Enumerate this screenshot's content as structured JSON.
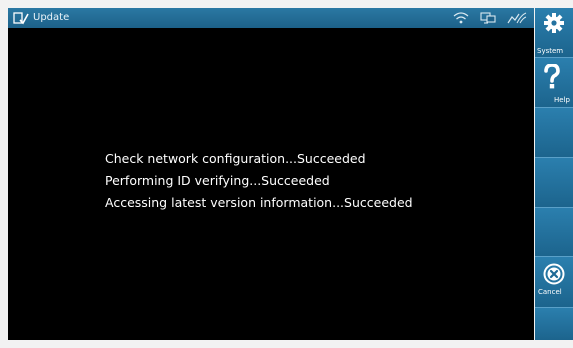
{
  "window": {
    "title": "Update",
    "title_icon": "update-icon"
  },
  "status_bar": {
    "icons": [
      "wifi-icon",
      "network-icon",
      "signal-icon"
    ]
  },
  "messages": [
    "Check network configuration...Succeeded",
    "Performing ID verifying...Succeeded",
    "Accessing latest version information...Succeeded"
  ],
  "sidebar": {
    "buttons": [
      {
        "label": "System",
        "icon": "gear-icon"
      },
      {
        "label": "Help",
        "icon": "question-icon"
      },
      {
        "label": "",
        "icon": ""
      },
      {
        "label": "",
        "icon": ""
      },
      {
        "label": "",
        "icon": ""
      },
      {
        "label": "Cancel",
        "icon": "cancel-icon"
      },
      {
        "label": "",
        "icon": ""
      }
    ]
  },
  "colors": {
    "titlebar": "#1d6189",
    "sidebar": "#1f6a96",
    "background": "#000000",
    "text": "#ffffff"
  }
}
